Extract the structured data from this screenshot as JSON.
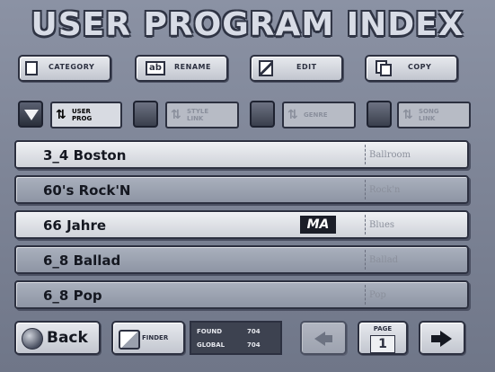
{
  "title": "USER PROGRAM INDEX",
  "toolbar": {
    "category": "CATEGORY",
    "rename": "RENAME",
    "edit": "EDIT",
    "copy": "COPY",
    "rename_icon_text": "ab"
  },
  "sort": {
    "user_prog": "USER\nPROG",
    "style_link": "STYLE\nLINK",
    "genre": "GENRE",
    "song_link": "SONG\nLINK"
  },
  "programs": [
    {
      "name": "3_4 Boston",
      "category": "Ballroom",
      "badge": ""
    },
    {
      "name": "60's Rock'N",
      "category": "Rock'n",
      "badge": ""
    },
    {
      "name": "66 Jahre",
      "category": "Blues",
      "badge": "MA"
    },
    {
      "name": "6_8 Ballad",
      "category": "Ballad",
      "badge": ""
    },
    {
      "name": "6_8 Pop",
      "category": "Pop",
      "badge": ""
    }
  ],
  "bottom": {
    "back": "Back",
    "finder": "FINDER",
    "found_label": "FOUND",
    "found_value": "704",
    "global_label": "GLOBAL",
    "global_value": "704",
    "page_label": "PAGE",
    "page_value": "1"
  }
}
